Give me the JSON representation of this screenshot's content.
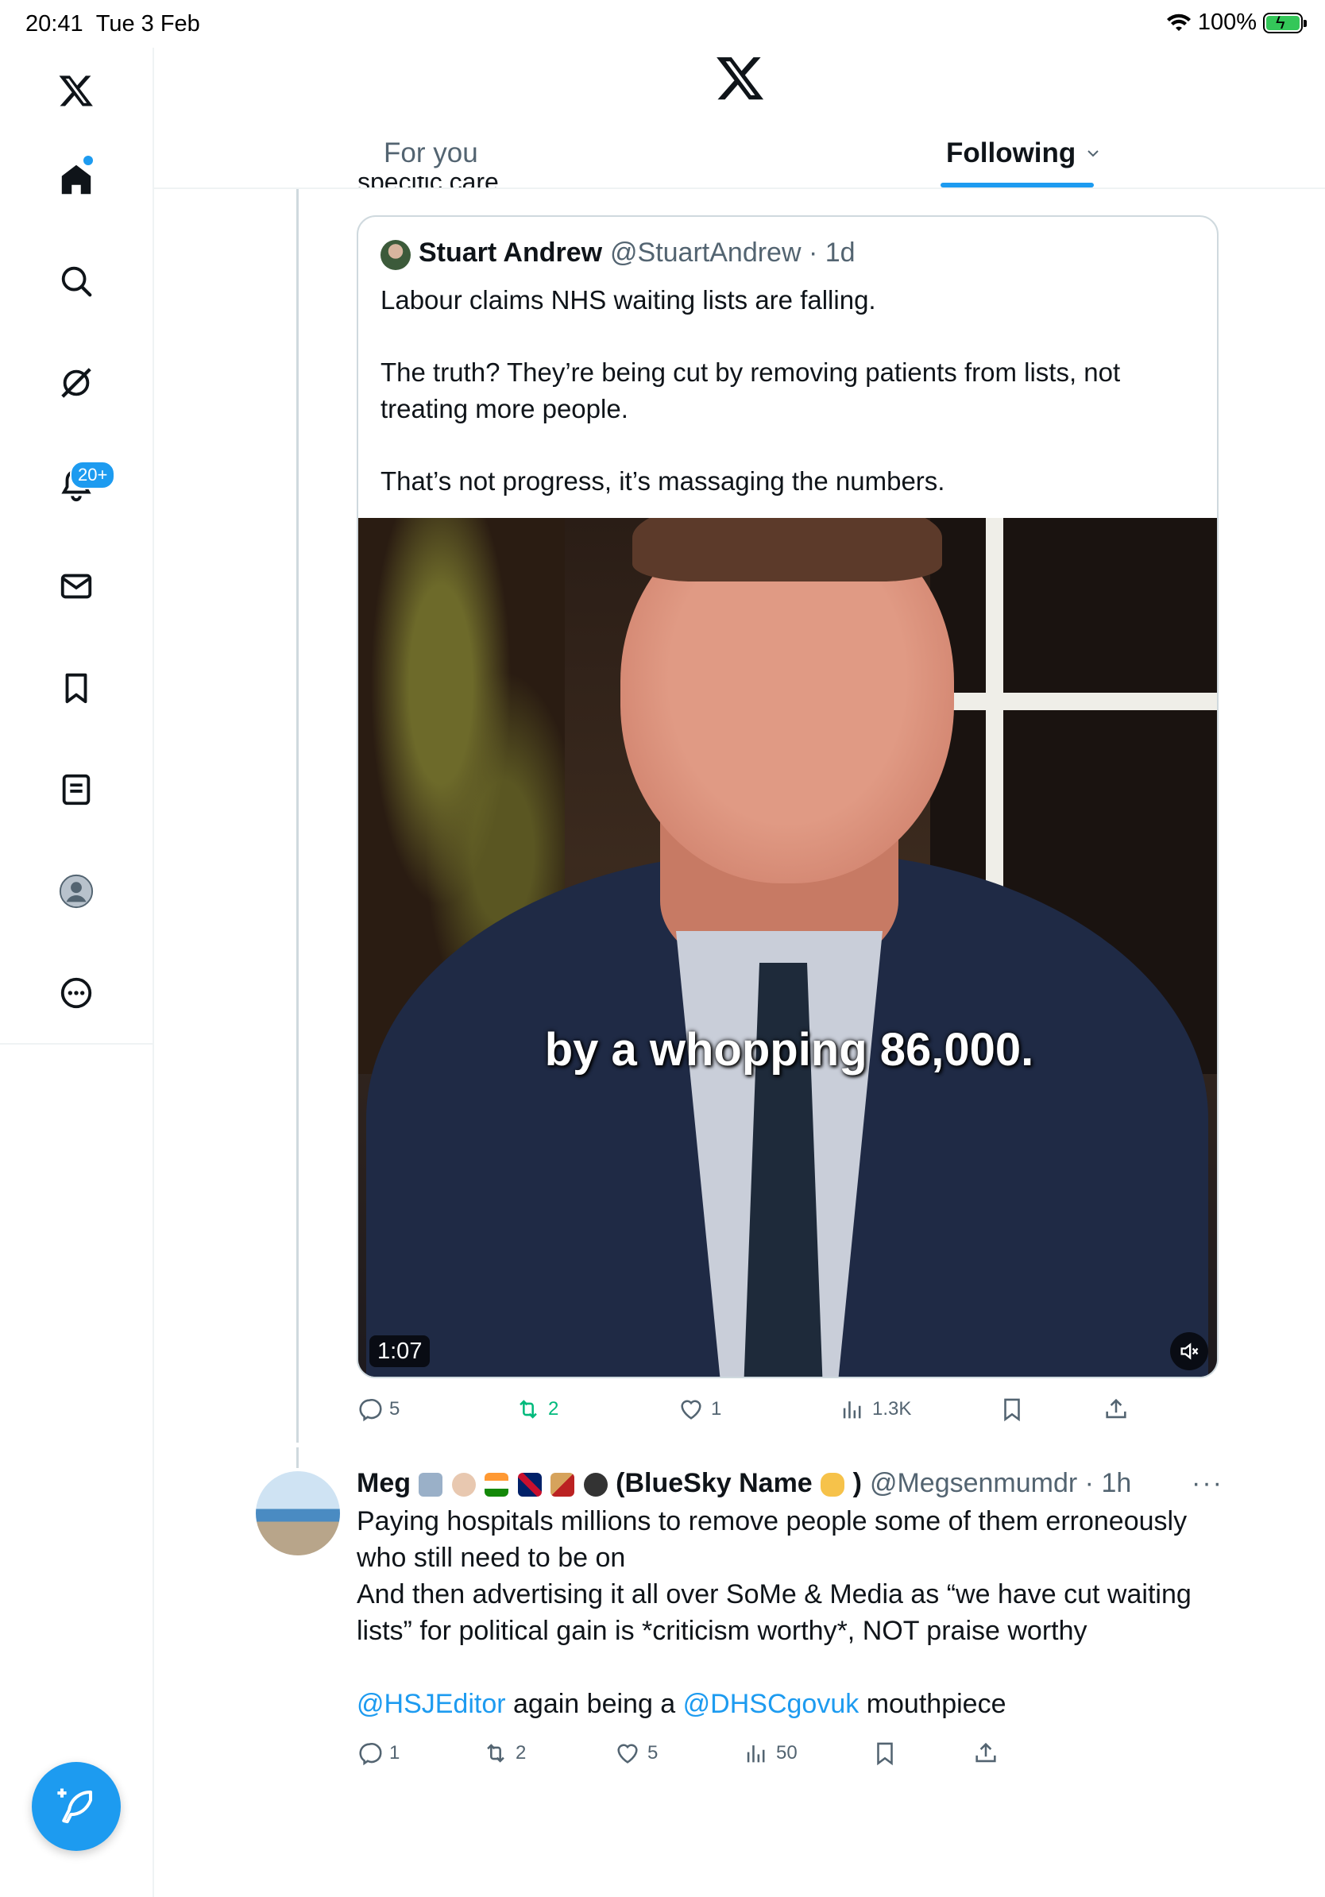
{
  "status_bar": {
    "time": "20:41",
    "date": "Tue 3 Feb",
    "battery": "100%"
  },
  "sidebar": {
    "items": [
      {
        "name": "home",
        "icon": "home-icon"
      },
      {
        "name": "explore",
        "icon": "search-icon"
      },
      {
        "name": "grok",
        "icon": "grok-icon"
      },
      {
        "name": "notifications",
        "icon": "bell-icon",
        "badge": "20+"
      },
      {
        "name": "messages",
        "icon": "envelope-icon"
      },
      {
        "name": "bookmarks",
        "icon": "bookmark-icon"
      },
      {
        "name": "lists",
        "icon": "list-icon"
      },
      {
        "name": "profile",
        "icon": "avatar-icon"
      },
      {
        "name": "more",
        "icon": "more-icon"
      }
    ]
  },
  "header": {
    "tabs": [
      {
        "label": "For you",
        "active": false
      },
      {
        "label": "Following",
        "active": true
      }
    ]
  },
  "timeline": {
    "cut_text": "specific care.",
    "quote": {
      "name": "Stuart Andrew",
      "handle": "@StuartAndrew",
      "time": "· 1d",
      "paragraphs": [
        "Labour claims NHS waiting lists are falling.",
        "The truth? They’re being cut by removing patients from lists, not treating more people.",
        "That’s not progress, it’s massaging the numbers."
      ],
      "video": {
        "caption": "by a whopping 86,000.",
        "duration": "1:07"
      }
    },
    "quote_actions": {
      "replies": "5",
      "reposts": "2",
      "likes": "1",
      "views": "1.3K"
    },
    "reply": {
      "name_prefix": "Meg",
      "name_suffix": "(BlueSky Name",
      "name_close": ")",
      "handle": "@Megsenmumdr",
      "time": "· 1h",
      "lines": [
        "Paying hospitals millions to remove people some of them erroneously who still need to be on",
        "And then advertising it all over SoMe & Media as “we have cut waiting lists” for political gain is *criticism worthy*, NOT praise worthy"
      ],
      "mention1": "@HSJEditor",
      "mid_text": " again being a ",
      "mention2": "@DHSCgovuk",
      "end_text": " mouthpiece"
    },
    "reply_actions": {
      "replies": "1",
      "reposts": "2",
      "likes": "5",
      "views": "50"
    }
  },
  "colors": {
    "accent": "#1d9bf0",
    "repost_active": "#00ba7c",
    "secondary_text": "#536471"
  }
}
